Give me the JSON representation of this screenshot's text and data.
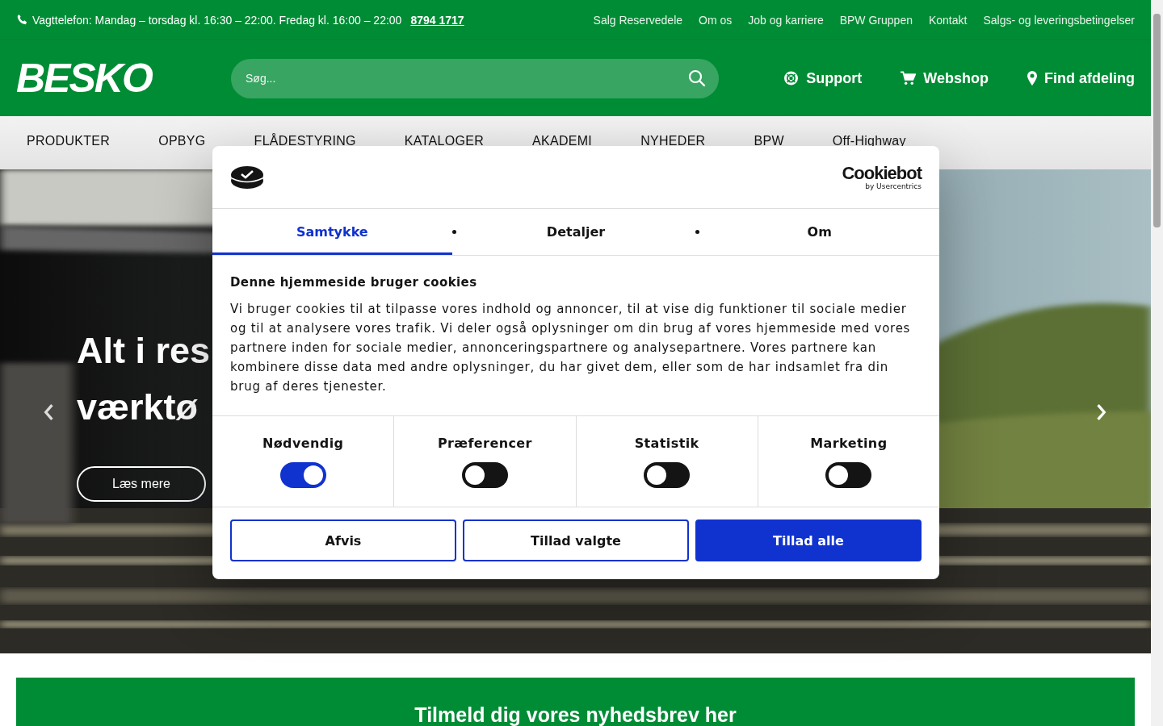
{
  "top_bar": {
    "phone_text": "Vagttelefon: Mandag – torsdag kl. 16:30 – 22:00. Fredag kl. 16:00 – 22:00",
    "phone_number": "8794 1717",
    "links": [
      "Salg Reservedele",
      "Om os",
      "Job og karriere",
      "BPW Gruppen",
      "Kontakt",
      "Salgs- og leveringsbetingelser"
    ]
  },
  "header": {
    "logo": "BESKO",
    "search": {
      "placeholder": "Søg..."
    },
    "actions": [
      "Support",
      "Webshop",
      "Find afdeling"
    ]
  },
  "nav": [
    "PRODUKTER",
    "OPBYG",
    "FLÅDESTYRING",
    "KATALOGER",
    "AKADEMI",
    "NYHEDER",
    "BPW",
    "Off-Highway"
  ],
  "hero": {
    "title_lines": [
      "Alt i res",
      "værktø"
    ],
    "button": "Læs mere"
  },
  "cookie_dialog": {
    "logo_text": "Cookiebot",
    "logo_sub": "by Usercentrics",
    "tabs": [
      {
        "label": "Samtykke",
        "selected": true
      },
      {
        "label": "Detaljer",
        "selected": false
      },
      {
        "label": "Om",
        "selected": false
      }
    ],
    "heading": "Denne hjemmeside bruger cookies",
    "body": "Vi bruger cookies til at tilpasse vores indhold og annoncer, til at vise dig funktioner til sociale medier og til at analysere vores trafik. Vi deler også oplysninger om din brug af vores hjemmeside med vores partnere inden for sociale medier, annonceringspartnere og analysepartnere. Vores partnere kan kombinere disse data med andre oplysninger, du har givet dem, eller som de har indsamlet fra din brug af deres tjenester.",
    "categories": [
      {
        "label": "Nødvendig",
        "checked": true
      },
      {
        "label": "Præferencer",
        "checked": false
      },
      {
        "label": "Statistik",
        "checked": false
      },
      {
        "label": "Marketing",
        "checked": false
      }
    ],
    "buttons": [
      {
        "label": "Afvis",
        "kind": "outline"
      },
      {
        "label": "Tillad valgte",
        "kind": "outline"
      },
      {
        "label": "Tillad alle",
        "kind": "primary"
      }
    ]
  },
  "newsletter": {
    "title": "Tilmeld dig vores nyhedsbrev her"
  }
}
